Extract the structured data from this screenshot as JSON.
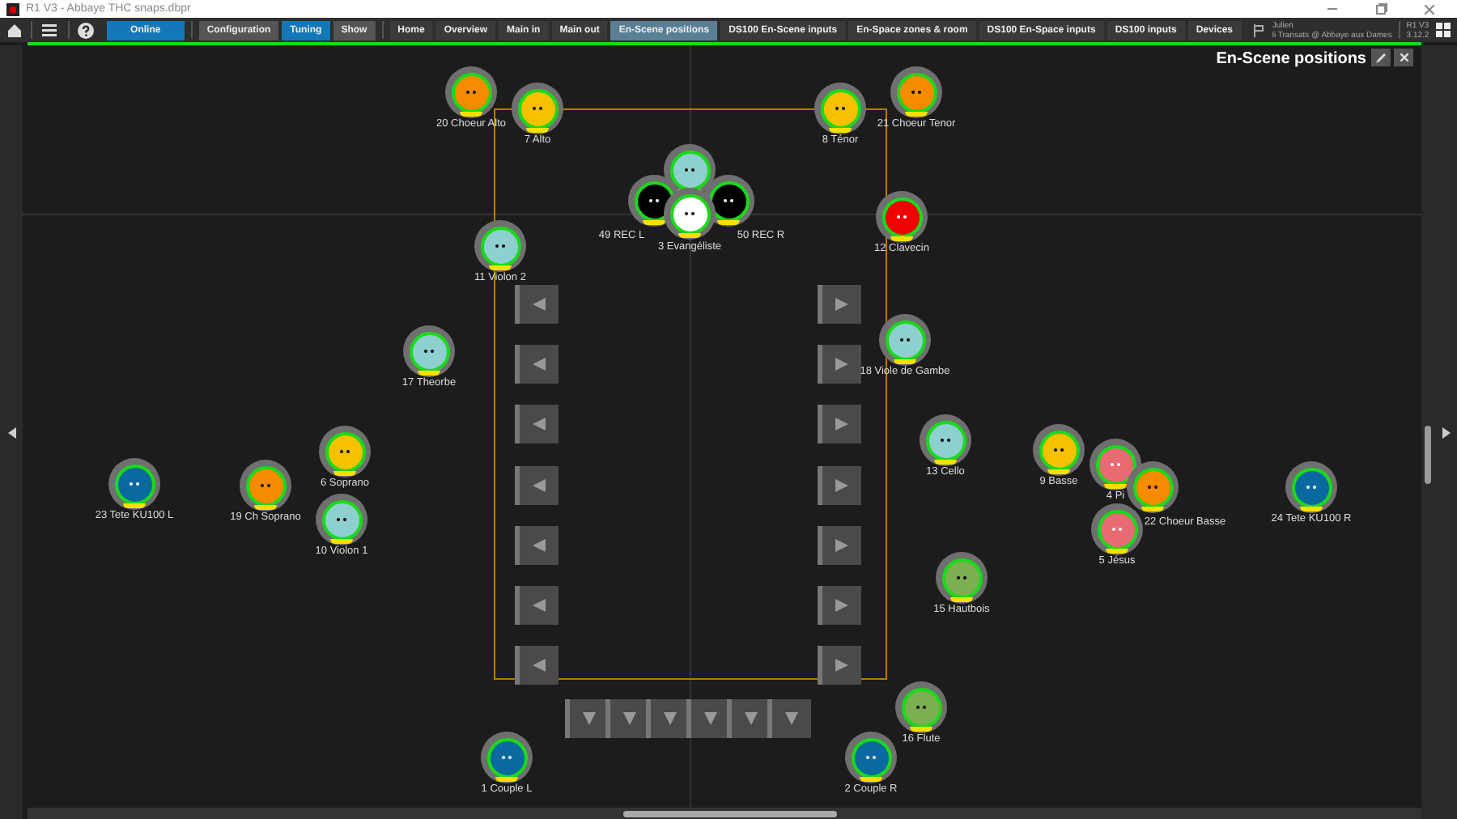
{
  "window": {
    "title": "R1 V3 - Abbaye THC snaps.dbpr"
  },
  "toolbar": {
    "online": {
      "label": "Online",
      "on": true
    },
    "modes": [
      {
        "label": "Configuration",
        "selected": false
      },
      {
        "label": "Tuning",
        "selected": true
      },
      {
        "label": "Show",
        "selected": false
      }
    ],
    "tabs": [
      {
        "label": "Home",
        "selected": false
      },
      {
        "label": "Overview",
        "selected": false
      },
      {
        "label": "Main in",
        "selected": false
      },
      {
        "label": "Main out",
        "selected": false
      },
      {
        "label": "En-Scene positions",
        "selected": true
      },
      {
        "label": "DS100 En-Scene inputs",
        "selected": false
      },
      {
        "label": "En-Space zones & room",
        "selected": false
      },
      {
        "label": "DS100 En-Space inputs",
        "selected": false
      },
      {
        "label": "DS100 inputs",
        "selected": false
      },
      {
        "label": "Devices",
        "selected": false
      }
    ],
    "user": {
      "name": "Julien",
      "project": "li Transats @ Abbaye aux Dames"
    },
    "version": {
      "name": "R1 V3",
      "number": "3.12.2"
    }
  },
  "panel": {
    "title": "En-Scene positions"
  },
  "sources": [
    {
      "label": "20 Choeur Alto",
      "color": "#f68b00"
    },
    {
      "label": "7 Alto",
      "color": "#f7c100"
    },
    {
      "label": "8 Ténor",
      "color": "#f7c100"
    },
    {
      "label": "21 Choeur Tenor",
      "color": "#f68b00"
    },
    {
      "color": "#8ed0d0"
    },
    {
      "label": "49 REC L",
      "color": "#000000"
    },
    {
      "label": "50 REC R",
      "color": "#000000"
    },
    {
      "label": "3 Evangéliste",
      "color": "#ffffff"
    },
    {
      "label": "12 Clavecin",
      "color": "#f00000"
    },
    {
      "label": "11 Violon 2",
      "color": "#8ed0d0"
    },
    {
      "label": "17 Theorbe",
      "color": "#8ed0d0"
    },
    {
      "label": "18 Viole de Gambe",
      "color": "#8ed0d0"
    },
    {
      "label": "13 Cello",
      "color": "#8ed0d0"
    },
    {
      "label": "9 Basse",
      "color": "#f7c100"
    },
    {
      "label": "4 Pi",
      "color": "#e86a72"
    },
    {
      "label": "22 Choeur Basse",
      "color": "#f68b00"
    },
    {
      "label": "5 Jésus",
      "color": "#e86a72"
    },
    {
      "label": "24 Tete KU100 R",
      "color": "#0a6aa0"
    },
    {
      "label": "23 Tete KU100 L",
      "color": "#0a6aa0"
    },
    {
      "label": "19 Ch Soprano",
      "color": "#f68b00"
    },
    {
      "label": "6 Soprano",
      "color": "#f7c100"
    },
    {
      "label": "10 Violon 1",
      "color": "#8ed0d0"
    },
    {
      "label": "15 Hautbois",
      "color": "#7ab050"
    },
    {
      "label": "16 Flute",
      "color": "#7ab050"
    },
    {
      "label": "1 Couple L",
      "color": "#0a6aa0"
    },
    {
      "label": "2 Couple R",
      "color": "#0a6aa0"
    }
  ]
}
